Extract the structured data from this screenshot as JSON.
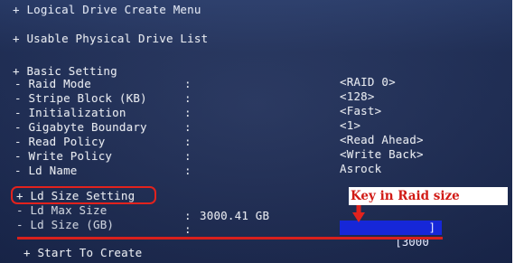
{
  "menu": {
    "title": "+ Logical Drive Create Menu",
    "usable_physical": "+ Usable Physical Drive List",
    "basic_setting": "+ Basic Setting",
    "rows": [
      {
        "label": "- Raid Mode",
        "colon": ":",
        "value": "<RAID 0>"
      },
      {
        "label": "- Stripe Block (KB)",
        "colon": ":",
        "value": "<128>"
      },
      {
        "label": "- Initialization",
        "colon": ":",
        "value": "<Fast>"
      },
      {
        "label": "- Gigabyte Boundary",
        "colon": ":",
        "value": "<1>"
      },
      {
        "label": "- Read Policy",
        "colon": ":",
        "value": "<Read Ahead>"
      },
      {
        "label": "- Write Policy",
        "colon": ":",
        "value": "<Write Back>"
      },
      {
        "label": "- Ld Name",
        "colon": ":",
        "value": "Asrock"
      }
    ],
    "ld_size_setting": "+ Ld Size Setting",
    "ld_max_size": {
      "label": "- Ld Max Size",
      "colon": ":",
      "value": "3000.41 GB"
    },
    "ld_size": {
      "label": "- Ld Size (GB)",
      "colon": ":",
      "input_open": "[3000",
      "input_close": "]"
    },
    "start_to_create": "+ Start To Create"
  },
  "annotation": {
    "callout_text": "Key in Raid size",
    "highlight_color": "#e2221d",
    "input_bg_color": "#1627d8"
  }
}
